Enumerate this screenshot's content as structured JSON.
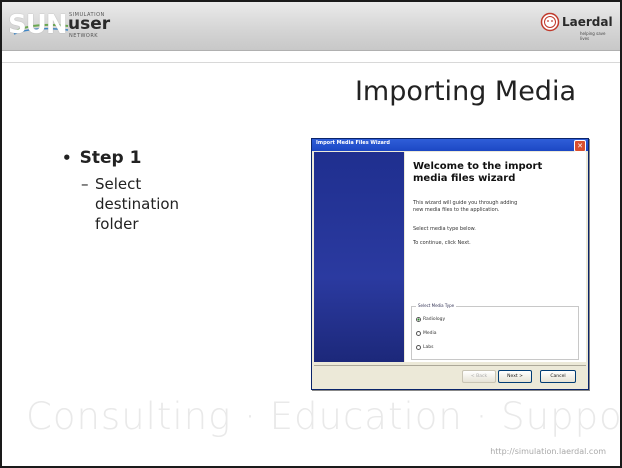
{
  "header": {
    "sun_logo": {
      "letters": "SUN",
      "small_top": "SIMULATION",
      "user": "user",
      "network": "NETWORK"
    },
    "laerdal_logo": {
      "name": "Laerdal",
      "tagline": "helping save lives"
    }
  },
  "slide": {
    "title": "Importing Media",
    "bullet": {
      "label": "Step 1",
      "sub": "Select destination folder"
    }
  },
  "wizard": {
    "window_title": "Import Media Files Wizard",
    "close_glyph": "✕",
    "heading": "Welcome to the import media files wizard",
    "paragraphs": [
      "This wizard will guide you through adding new media files to the application.",
      "Select media type below.",
      "To continue, click Next."
    ],
    "group_label": "Select Media Type",
    "radio_options": [
      {
        "label": "Radiology",
        "selected": true
      },
      {
        "label": "Media",
        "selected": false
      },
      {
        "label": "Labs",
        "selected": false
      }
    ],
    "buttons": {
      "back": "< Back",
      "next": "Next >",
      "cancel": "Cancel"
    },
    "colors": {
      "titlebar": "#1c47c4",
      "banner": "#1f2f8f"
    }
  },
  "footer": {
    "watermark": "Consulting · Education · Support",
    "url": "http://simulation.laerdal.com"
  }
}
